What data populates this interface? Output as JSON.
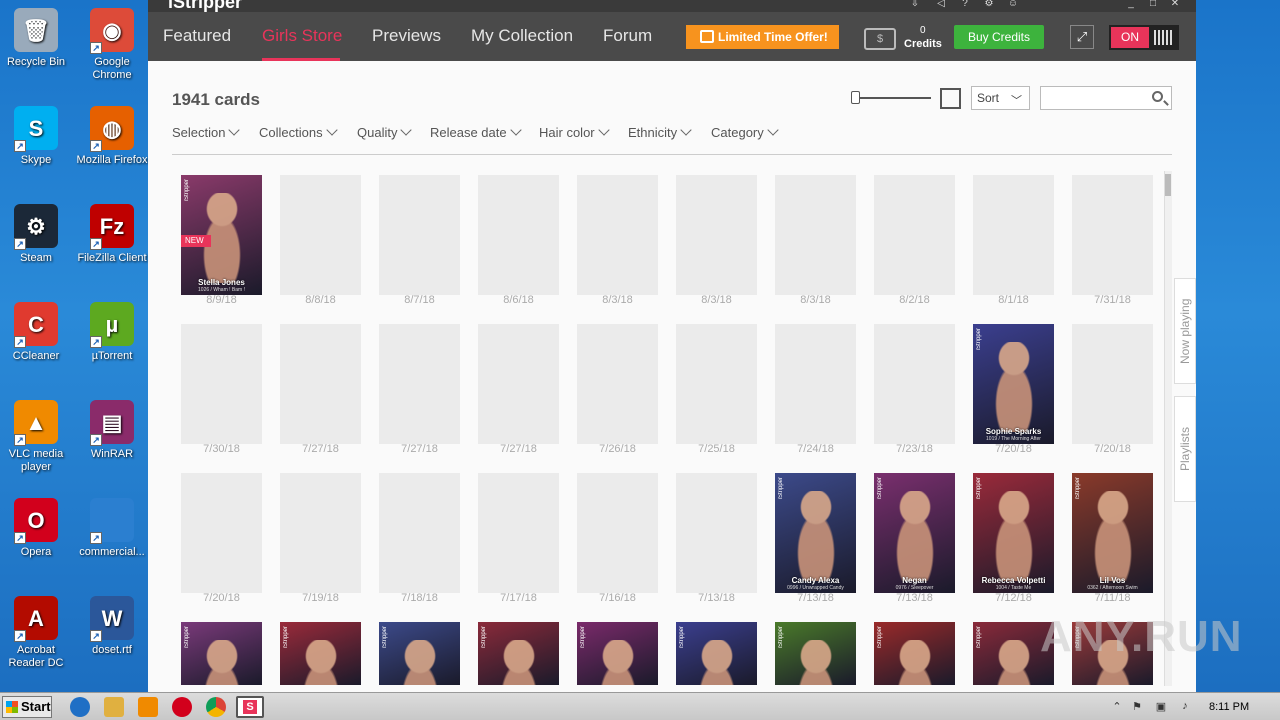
{
  "desktop": {
    "icons": [
      {
        "label": "Recycle Bin",
        "icon": "recycle-bin-icon",
        "color": "#9ab"
      },
      {
        "label": "Google Chrome",
        "icon": "chrome-icon",
        "color": "#dd4b39"
      },
      {
        "label": "Skype",
        "icon": "skype-icon",
        "color": "#00aff0"
      },
      {
        "label": "Mozilla Firefox",
        "icon": "firefox-icon",
        "color": "#e66000"
      },
      {
        "label": "Steam",
        "icon": "steam-icon",
        "color": "#1b2838"
      },
      {
        "label": "FileZilla Client",
        "icon": "filezilla-icon",
        "color": "#bf0000"
      },
      {
        "label": "CCleaner",
        "icon": "ccleaner-icon",
        "color": "#e03a2f"
      },
      {
        "label": "µTorrent",
        "icon": "utorrent-icon",
        "color": "#5da920"
      },
      {
        "label": "VLC media player",
        "icon": "vlc-icon",
        "color": "#f08a00"
      },
      {
        "label": "WinRAR",
        "icon": "winrar-icon",
        "color": "#8a2b6a"
      },
      {
        "label": "Opera",
        "icon": "opera-icon",
        "color": "#d2001c"
      },
      {
        "label": "commercial...",
        "icon": "folder-icon",
        "color": "#2b7fd0"
      },
      {
        "label": "Acrobat Reader DC",
        "icon": "acrobat-icon",
        "color": "#b30b00"
      },
      {
        "label": "doset.rtf",
        "icon": "word-doc-icon",
        "color": "#2b579a"
      }
    ]
  },
  "app": {
    "title": "iStripper",
    "nav": [
      "Featured",
      "Girls Store",
      "Previews",
      "My Collection",
      "Forum"
    ],
    "active_nav": "Girls Store",
    "offer_label": "Limited Time Offer!",
    "credits_count": "0",
    "credits_label": "Credits",
    "buy_label": "Buy Credits",
    "toggle_label": "ON",
    "accent": "#e8345a",
    "offer_color": "#f7931e",
    "buy_color": "#3db33d"
  },
  "store": {
    "count": "1941 cards",
    "sort_label": "Sort",
    "search_placeholder": "",
    "filters": [
      "Selection",
      "Collections",
      "Quality",
      "Release date",
      "Hair color",
      "Ethnicity",
      "Category"
    ],
    "rows": [
      [
        {
          "date": "8/9/18",
          "name": "Stella Jones",
          "sub": "1026 / Wham ! Bam !",
          "new": "NEW",
          "img": true,
          "bg": "#8a3a6a"
        },
        {
          "date": "8/8/18"
        },
        {
          "date": "8/7/18"
        },
        {
          "date": "8/6/18"
        },
        {
          "date": "8/3/18"
        },
        {
          "date": "8/3/18"
        },
        {
          "date": "8/3/18"
        },
        {
          "date": "8/2/18"
        },
        {
          "date": "8/1/18"
        },
        {
          "date": "7/31/18"
        }
      ],
      [
        {
          "date": "7/30/18"
        },
        {
          "date": "7/27/18"
        },
        {
          "date": "7/27/18"
        },
        {
          "date": "7/27/18"
        },
        {
          "date": "7/26/18"
        },
        {
          "date": "7/25/18"
        },
        {
          "date": "7/24/18"
        },
        {
          "date": "7/23/18"
        },
        {
          "date": "7/20/18",
          "name": "Sophie Sparks",
          "sub": "1019 / The Morning After",
          "img": true,
          "bg": "#3b3f8f"
        },
        {
          "date": "7/20/18"
        }
      ],
      [
        {
          "date": "7/20/18"
        },
        {
          "date": "7/19/18"
        },
        {
          "date": "7/18/18"
        },
        {
          "date": "7/17/18"
        },
        {
          "date": "7/16/18"
        },
        {
          "date": "7/13/18"
        },
        {
          "date": "7/13/18",
          "name": "Candy Alexa",
          "sub": "0996 / Unwrapped Candy",
          "img": true,
          "bg": "#3c4a8a"
        },
        {
          "date": "7/13/18",
          "name": "Negan",
          "sub": "0976 / Sleepover",
          "img": true,
          "bg": "#7a2f6e"
        },
        {
          "date": "7/12/18",
          "name": "Rebecca Volpetti",
          "sub": "1004 / Taste Me",
          "img": true,
          "bg": "#9a2a3a"
        },
        {
          "date": "7/11/18",
          "name": "Lil Vos",
          "sub": "0362 / Afternoon Swim",
          "img": true,
          "bg": "#8a3a2a"
        }
      ],
      [
        {
          "img": true,
          "bg": "#7a3a7a"
        },
        {
          "img": true,
          "bg": "#9a2a3a"
        },
        {
          "img": true,
          "bg": "#3c4a8a"
        },
        {
          "img": true,
          "bg": "#8a2a3a"
        },
        {
          "img": true,
          "bg": "#7a2a6a"
        },
        {
          "img": true,
          "bg": "#3b3f8f"
        },
        {
          "img": true,
          "bg": "#4a7a2a"
        },
        {
          "img": true,
          "bg": "#9a2a2a"
        },
        {
          "img": true,
          "bg": "#8a2a3a"
        },
        {
          "img": true,
          "bg": "#9a3a3a"
        }
      ]
    ],
    "brand_label": "iStripper",
    "side_tabs": [
      "Now playing",
      "Playlists"
    ]
  },
  "watermark": "ANY.RUN",
  "taskbar": {
    "start_label": "Start",
    "time": "8:11 PM"
  }
}
